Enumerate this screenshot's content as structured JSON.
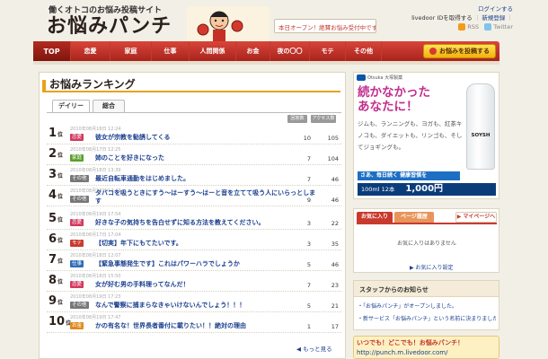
{
  "header": {
    "tagline": "働くオトコのお悩み投稿サイト",
    "logo": "お悩みパンチ",
    "announcement": "本日オープン！絶賛お悩み受付中です。",
    "login_link": "ログインする",
    "livedoor_text": "livedoor IDを取得する",
    "register_link": "新規登録",
    "rss_label": "RSS",
    "twitter_label": "Twitter"
  },
  "nav": {
    "items": [
      {
        "label": "TOP"
      },
      {
        "label": "恋愛"
      },
      {
        "label": "家庭"
      },
      {
        "label": "仕事"
      },
      {
        "label": "人間関係"
      },
      {
        "label": "お金"
      },
      {
        "label": "夜の〇〇"
      },
      {
        "label": "モテ"
      },
      {
        "label": "その他"
      }
    ],
    "post_button": "お悩みを投稿する"
  },
  "ranking": {
    "title": "お悩みランキング",
    "tabs": [
      "デイリー",
      "総合"
    ],
    "col_comments": "回答数",
    "col_access": "アクセス数",
    "rank_suffix": "位",
    "rows": [
      {
        "rank": "1",
        "date": "2010年08月18日 12:24",
        "category": "恋愛",
        "badge_color": "#d23a5e",
        "title": "彼女が宗教を勧誘してくる",
        "comments": "10",
        "access": "105"
      },
      {
        "rank": "2",
        "date": "2010年08月17日 12:25",
        "category": "家庭",
        "badge_color": "#5aa02c",
        "title": "姉のことを好きになった",
        "comments": "7",
        "access": "104"
      },
      {
        "rank": "3",
        "date": "2010年08月18日 13:39",
        "category": "その他",
        "badge_color": "#777777",
        "title": "最近自転車通勤をはじめました。",
        "comments": "7",
        "access": "46"
      },
      {
        "rank": "4",
        "date": "2010年08月18日 17:43",
        "category": "その他",
        "badge_color": "#777777",
        "title": "タバコを吸うときにすう〜はーすう〜はーと音を立てて吸う人にいらっとします",
        "comments": "9",
        "access": "46"
      },
      {
        "rank": "5",
        "date": "2010年08月19日 17:54",
        "category": "恋愛",
        "badge_color": "#d23a5e",
        "title": "好きな子の気持ちを告白せずに知る方法を教えてください。",
        "comments": "3",
        "access": "22"
      },
      {
        "rank": "6",
        "date": "2010年08月17日 17:04",
        "category": "モテ",
        "badge_color": "#c93a2e",
        "title": "【切実】年下にもてたいです。",
        "comments": "3",
        "access": "35"
      },
      {
        "rank": "7",
        "date": "2010年08月18日 12:07",
        "category": "仕事",
        "badge_color": "#2f6eb8",
        "title": "【緊急事態発生です】これはパワーハラでしょうか",
        "comments": "5",
        "access": "46"
      },
      {
        "rank": "8",
        "date": "2010年08月18日 15:50",
        "category": "恋愛",
        "badge_color": "#d23a5e",
        "title": "女が好む男の手料理ってなんだ！",
        "comments": "7",
        "access": "23"
      },
      {
        "rank": "9",
        "date": "2010年08月19日 17:23",
        "category": "その他",
        "badge_color": "#777777",
        "title": "なんで警察に捕まらなきゃいけないんでしょう！！！",
        "comments": "5",
        "access": "21"
      },
      {
        "rank": "10",
        "date": "2010年08月19日 17:47",
        "category": "お金",
        "badge_color": "#e08a1c",
        "title": "かの有名な！世界長者番付に載りたい！！絶対の理由",
        "comments": "1",
        "access": "17"
      }
    ],
    "more_link": "もっと見る"
  },
  "ad": {
    "brand": "Otsuka 大塚製薬",
    "headline_1": "続かなかった",
    "headline_2": "あなたに！",
    "body": "ジムも、ランニングも、ヨガも、紅茶キノコも、ダイエットも、リンゴも、そしてジョギングも。",
    "product": "SOYSH",
    "strip": "さあ、毎日続く 健康習慣を",
    "price_label": "100ml 12本",
    "price": "1,000円"
  },
  "favorites": {
    "tab_1": "お気に入り",
    "tab_2": "ページ履歴",
    "mypage_button": "マイページへ",
    "empty_text": "お気に入りはありません",
    "list_link": "お気に入り設定"
  },
  "staff": {
    "title": "スタッフからのお知らせ",
    "items": [
      "・「お悩みパンチ」がオープンしました。",
      "・新サービス「お悩みパンチ」という名前に決まりました"
    ]
  },
  "mobile": {
    "label": "いつでも！どこでも！お悩みパンチ！",
    "url": "http://punch.m.livedoor.com/"
  },
  "colors": {
    "nav_red": "#c62f25",
    "accent_orange": "#e8a21a",
    "link_blue": "#1a3f8f"
  }
}
